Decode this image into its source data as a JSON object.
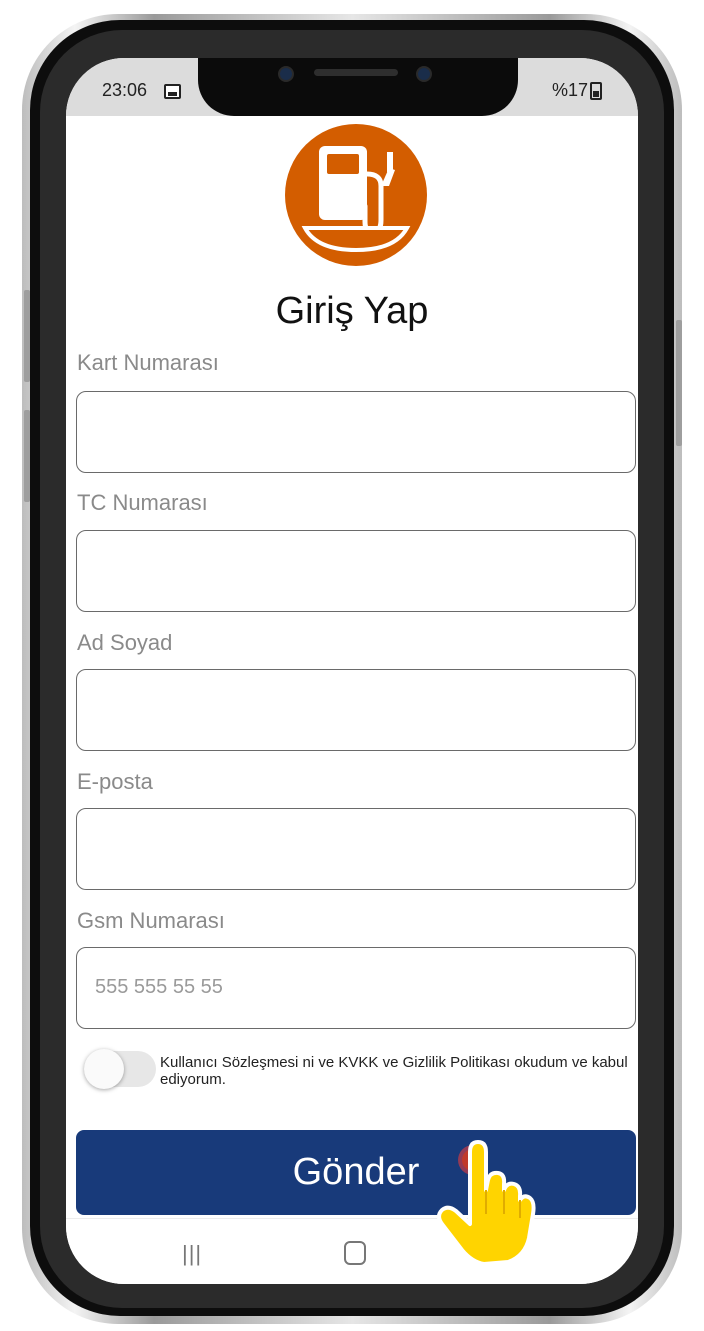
{
  "status_bar": {
    "time": "23:06",
    "battery": "%17",
    "image_icon": "image-notification-icon",
    "battery_icon": "battery-icon"
  },
  "app": {
    "logo_icon": "fuel-pump-icon",
    "brand_color": "#d35d00",
    "title": "Giriş Yap"
  },
  "form": {
    "card_number_label": "Kart Numarası",
    "tc_number_label": "TC Numarası",
    "full_name_label": "Ad Soyad",
    "email_label": "E-posta",
    "gsm_label": "Gsm Numarası",
    "gsm_placeholder": "555 555 55 55",
    "consent_text": "Kullanıcı Sözleşmesi ni ve KVKK ve Gizlilik Politikası okudum ve kabul ediyorum.",
    "consent_checked": false,
    "submit_label": "Gönder",
    "submit_color": "#183a7a"
  },
  "nav": {
    "recent_icon": "recent-apps-icon",
    "home_icon": "home-icon",
    "back_icon": "back-icon"
  },
  "overlay": {
    "tap_icon": "pointing-hand-icon"
  }
}
